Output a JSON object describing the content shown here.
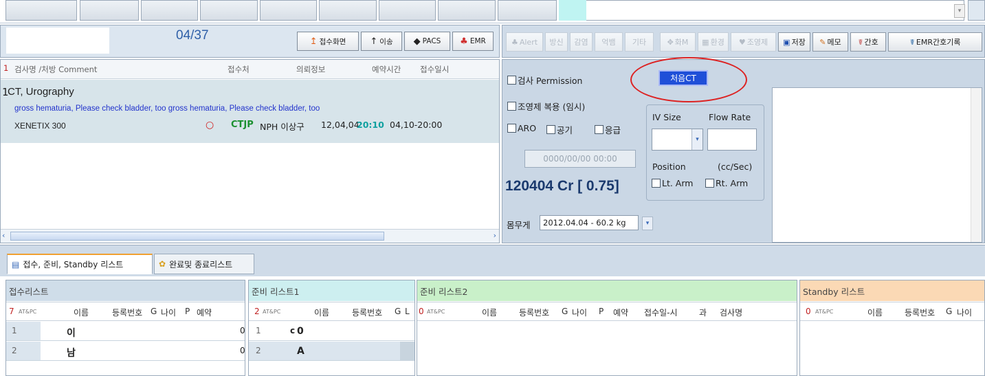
{
  "header": {
    "counter": "04/37",
    "buttons": [
      "접수화면",
      "이송",
      "PACS",
      "EMR"
    ]
  },
  "toolbar": {
    "buttons": [
      "Alert",
      "방신",
      "감염",
      "억뱀",
      "기타",
      "화M",
      "환경",
      "조영제",
      "저장",
      "메모",
      "간호",
      "EMR간호기록"
    ],
    "dim_flags": [
      true,
      true,
      true,
      true,
      true,
      true,
      true,
      true,
      false,
      false,
      false,
      false
    ]
  },
  "orders": {
    "columns": [
      "검사명 /처방 Comment",
      "접수처",
      "의뢰정보",
      "예약시간",
      "접수일시"
    ],
    "count": "1",
    "item": {
      "index": "1",
      "name": "CT, Urography",
      "comment": "gross hematuria, Please check bladder, too gross hematuria, Please check bladder, too",
      "contrast": "XENETIX 300",
      "marker": "○",
      "dept": "CTJP",
      "ward": "NPH 이상구",
      "reserve_date": "12,04,04",
      "reserve_time": "20:10",
      "receipt": "04,10-20:00"
    }
  },
  "form": {
    "permission": "검사 Permission",
    "contrast_agent": "조영제 복용 (임시)",
    "aro": "ARO",
    "air": "공기",
    "emergency": "응급",
    "first_ct": "처음CT",
    "iv_size": "IV Size",
    "flow_rate": "Flow Rate",
    "datetime_placeholder": "0000/00/00 00:00",
    "position": "Position",
    "unit": "(cc/Sec)",
    "lt_arm": "Lt. Arm",
    "rt_arm": "Rt. Arm",
    "cr_label": "120404 Cr [ 0.75]",
    "weight_label": "몸무게",
    "weight_value": "2012.04.04 - 60.2 kg"
  },
  "tabs": [
    {
      "label": "접수, 준비, Standby 리스트",
      "active": true
    },
    {
      "label": "완료및 종료리스트",
      "active": false
    }
  ],
  "lists": {
    "reception": {
      "title": "접수리스트",
      "count": "7",
      "cols": [
        "AT&PC",
        "이름",
        "등록번호",
        "G",
        "나이",
        "P",
        "예약"
      ],
      "rows": [
        {
          "n": "1",
          "name": "이",
          "edge": "0"
        },
        {
          "n": "2",
          "name": "남",
          "edge": "0"
        }
      ]
    },
    "prep1": {
      "title": "준비 리스트1",
      "count": "2",
      "cols": [
        "AT&PC",
        "이름",
        "등록번호",
        "G",
        "L"
      ],
      "rows": [
        {
          "n": "1",
          "mark": "c",
          "name": "0"
        },
        {
          "n": "2",
          "mark": "",
          "name": "A"
        }
      ]
    },
    "prep2": {
      "title": "준비 리스트2",
      "count": "0",
      "cols": [
        "AT&PC",
        "이름",
        "등록번호",
        "G",
        "나이",
        "P",
        "예약",
        "접수일-시",
        "과",
        "검사명"
      ]
    },
    "standby": {
      "title": "Standby 리스트",
      "count": "0",
      "cols": [
        "AT&PC",
        "이름",
        "등록번호",
        "G",
        "나이"
      ]
    }
  },
  "colors": {
    "reception_title_bg": "#cfdde9",
    "prep1_title_bg": "#cdeff0",
    "prep2_title_bg": "#c9f0c9",
    "standby_title_bg": "#fbd9b5",
    "highlight_red": "#dd2222",
    "first_ct_bg": "#1f4fd8"
  }
}
